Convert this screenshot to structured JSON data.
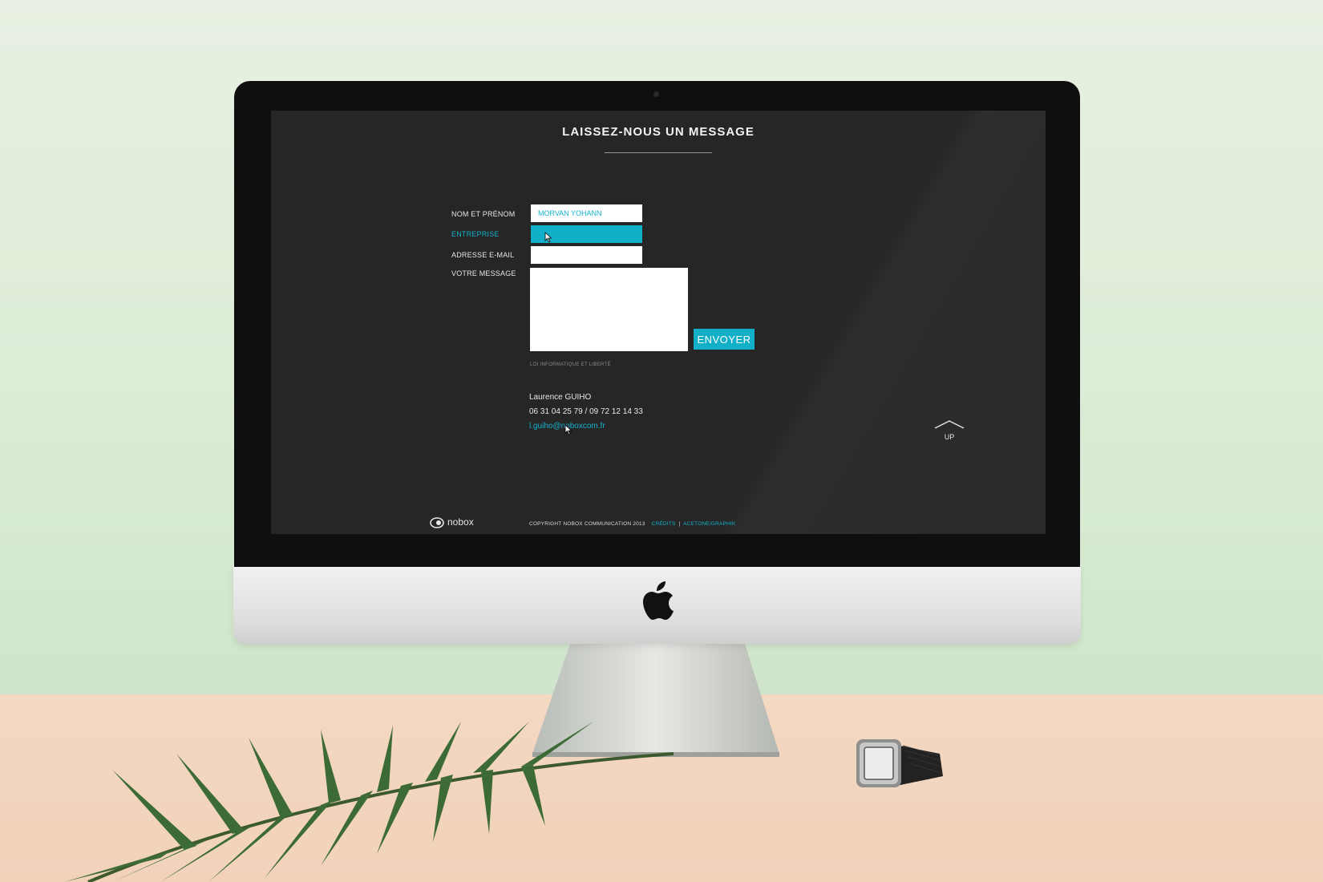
{
  "page": {
    "title": "LAISSEZ-NOUS UN MESSAGE"
  },
  "form": {
    "name_label": "NOM ET PRÉNOM",
    "name_value": "MORVAN YOHANN",
    "company_label": "ENTREPRISE",
    "company_value": "",
    "email_label": "ADRESSE E-MAIL",
    "email_value": "",
    "message_label": "VOTRE MESSAGE",
    "message_value": "",
    "submit_label": "ENVOYER",
    "legal_link": "LOI INFORMATIQUE ET LIBERTÉ"
  },
  "contact": {
    "name": "Laurence GUIHO",
    "phone": "06 31 04 25 79 / 09 72 12 14 33",
    "email": "l.guiho@noboxcom.fr"
  },
  "nav": {
    "up_label": "UP"
  },
  "footer": {
    "logo_text": "nobox",
    "copyright": "COPYRIGHT NOBOX COMMUNICATION 2013",
    "credits_label": "CRÉDITS",
    "credits_author": "ACETONE/GRAPHIK"
  },
  "colors": {
    "accent": "#12b0c8",
    "screen_background": "#262627",
    "text": "#e6e6e6"
  },
  "icons": [
    "apple-logo-icon",
    "chevron-up-icon",
    "nobox-logo-icon",
    "mouse-cursor-icon"
  ]
}
